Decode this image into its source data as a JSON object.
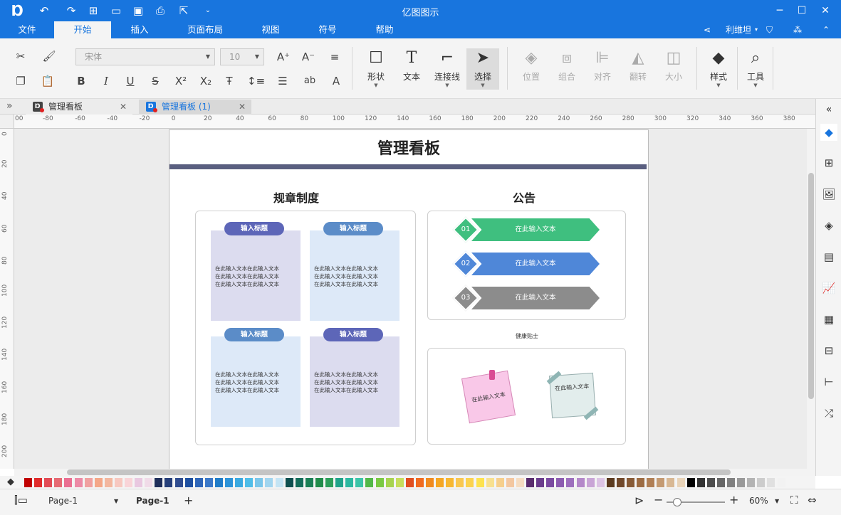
{
  "app": {
    "title": "亿图图示"
  },
  "menu": {
    "tabs": [
      "文件",
      "开始",
      "插入",
      "页面布局",
      "视图",
      "符号",
      "帮助"
    ],
    "active": "开始",
    "user": "利维坦"
  },
  "ribbon": {
    "font_name": "宋体",
    "font_size": "10",
    "tools": [
      {
        "key": "shape",
        "label": "形状",
        "icon": "square-icon"
      },
      {
        "key": "text",
        "label": "文本",
        "icon": "text-t-icon"
      },
      {
        "key": "connector",
        "label": "连接线",
        "icon": "connector-icon"
      },
      {
        "key": "select",
        "label": "选择",
        "icon": "cursor-icon"
      },
      {
        "key": "position",
        "label": "位置",
        "icon": "layers-icon"
      },
      {
        "key": "group",
        "label": "组合",
        "icon": "group-icon"
      },
      {
        "key": "align",
        "label": "对齐",
        "icon": "align-icon"
      },
      {
        "key": "flip",
        "label": "翻转",
        "icon": "flip-icon"
      },
      {
        "key": "size",
        "label": "大小",
        "icon": "size-icon"
      },
      {
        "key": "style",
        "label": "样式",
        "icon": "paint-bucket-icon"
      },
      {
        "key": "tools",
        "label": "工具",
        "icon": "tools-icon"
      }
    ]
  },
  "tabs": [
    {
      "label": "管理看板",
      "active": false
    },
    {
      "label": "管理看板 (1)",
      "active": true
    }
  ],
  "ruler": {
    "h": [
      "00",
      "-80",
      "-60",
      "-40",
      "-20",
      "0",
      "20",
      "40",
      "60",
      "80",
      "100",
      "120",
      "140",
      "160",
      "180",
      "200",
      "220",
      "240",
      "260",
      "280",
      "300",
      "320",
      "340",
      "360",
      "380"
    ],
    "v": [
      "0",
      "20",
      "40",
      "60",
      "80",
      "100",
      "120",
      "140",
      "160",
      "180",
      "200"
    ]
  },
  "board": {
    "title": "管理看板",
    "rules_title": "规章制度",
    "notice_title": "公告",
    "health_title": "健康贴士",
    "card_heading": "输入标题",
    "card_text": [
      "在此输入文本在此输入文本",
      "在此输入文本在此输入文本",
      "在此输入文本在此输入文本"
    ],
    "notices": [
      {
        "num": "01",
        "text": "在此输入文本",
        "color": "#3fbf7f"
      },
      {
        "num": "02",
        "text": "在此输入文本",
        "color": "#4f87d8"
      },
      {
        "num": "03",
        "text": "在此输入文本",
        "color": "#8c8c8c"
      }
    ],
    "sticky_text": "在此输入文本"
  },
  "status": {
    "page_selector": "Page-1",
    "page_tab": "Page-1",
    "zoom": "60%"
  },
  "colors": {
    "accent": "#1875de",
    "palette": [
      "#c00000",
      "#e02b2b",
      "#e24b55",
      "#e66a73",
      "#ea6f91",
      "#ec8aa6",
      "#f0a0a0",
      "#f4a788",
      "#f3b79f",
      "#f7c8c0",
      "#f9d4d8",
      "#e9c8e0",
      "#f0dbe8",
      "#1f2e5a",
      "#263f7a",
      "#2f4c8f",
      "#1d4fa0",
      "#2d65b8",
      "#3a78c8",
      "#1f7cc8",
      "#2c93d8",
      "#3aa9e0",
      "#4fbde8",
      "#7ac6ea",
      "#a1d5ef",
      "#c4e4f4",
      "#0d4f4f",
      "#146d5a",
      "#1a7f55",
      "#208c4a",
      "#2c9e5a",
      "#1fa38a",
      "#2cb8a0",
      "#3cc4a8",
      "#52b848",
      "#7ac943",
      "#a7d34f",
      "#c6dd5c",
      "#e04e1f",
      "#f06a1e",
      "#f08a1e",
      "#f5a623",
      "#f7b731",
      "#f9c74f",
      "#fbd24e",
      "#fde24f",
      "#f8e08f",
      "#f6cf8c",
      "#f3c7a0",
      "#f5dcc1",
      "#5a2d6e",
      "#6a3c8c",
      "#7a4aa0",
      "#8c5cb0",
      "#9d6fbd",
      "#b488c9",
      "#c9a5d6",
      "#dcc4e4",
      "#5b3a1e",
      "#70482a",
      "#875a36",
      "#9c6b42",
      "#b07f55",
      "#c49a72",
      "#d8b894",
      "#e8d3b8",
      "#000000",
      "#333333",
      "#4d4d4d",
      "#666666",
      "#808080",
      "#999999",
      "#b3b3b3",
      "#cccccc",
      "#e0e0e0",
      "#f2f2f2"
    ]
  }
}
